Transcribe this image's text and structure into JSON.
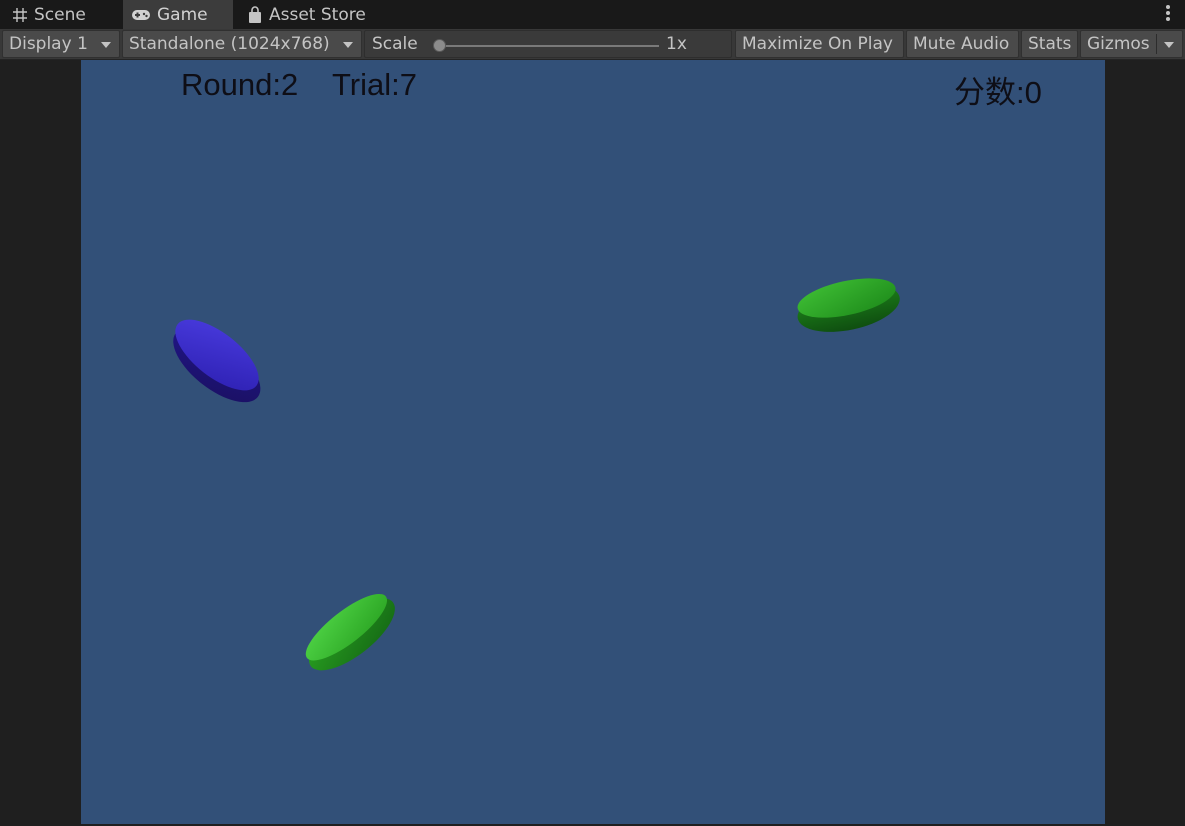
{
  "tabs": [
    {
      "label": "Scene",
      "icon": "grid-icon"
    },
    {
      "label": "Game",
      "icon": "gamepad-icon"
    },
    {
      "label": "Asset Store",
      "icon": "shopping-bag-icon"
    }
  ],
  "toolbar": {
    "display": "Display 1",
    "resolution": "Standalone (1024x768)",
    "scale_label": "Scale",
    "scale_value": "1x",
    "maximize_on_play": "Maximize On Play",
    "mute_audio": "Mute Audio",
    "stats": "Stats",
    "gizmos": "Gizmos"
  },
  "game": {
    "background_color": "#325078",
    "round_text": "Round:2",
    "trial_text": "Trial:7",
    "score_text": "分数:0",
    "discs": [
      {
        "name": "blue-disc",
        "color": "#2c1fb0"
      },
      {
        "name": "green-disc-right",
        "color": "#1d8a1a"
      },
      {
        "name": "green-disc-bottom",
        "color": "#2aa322"
      }
    ]
  }
}
